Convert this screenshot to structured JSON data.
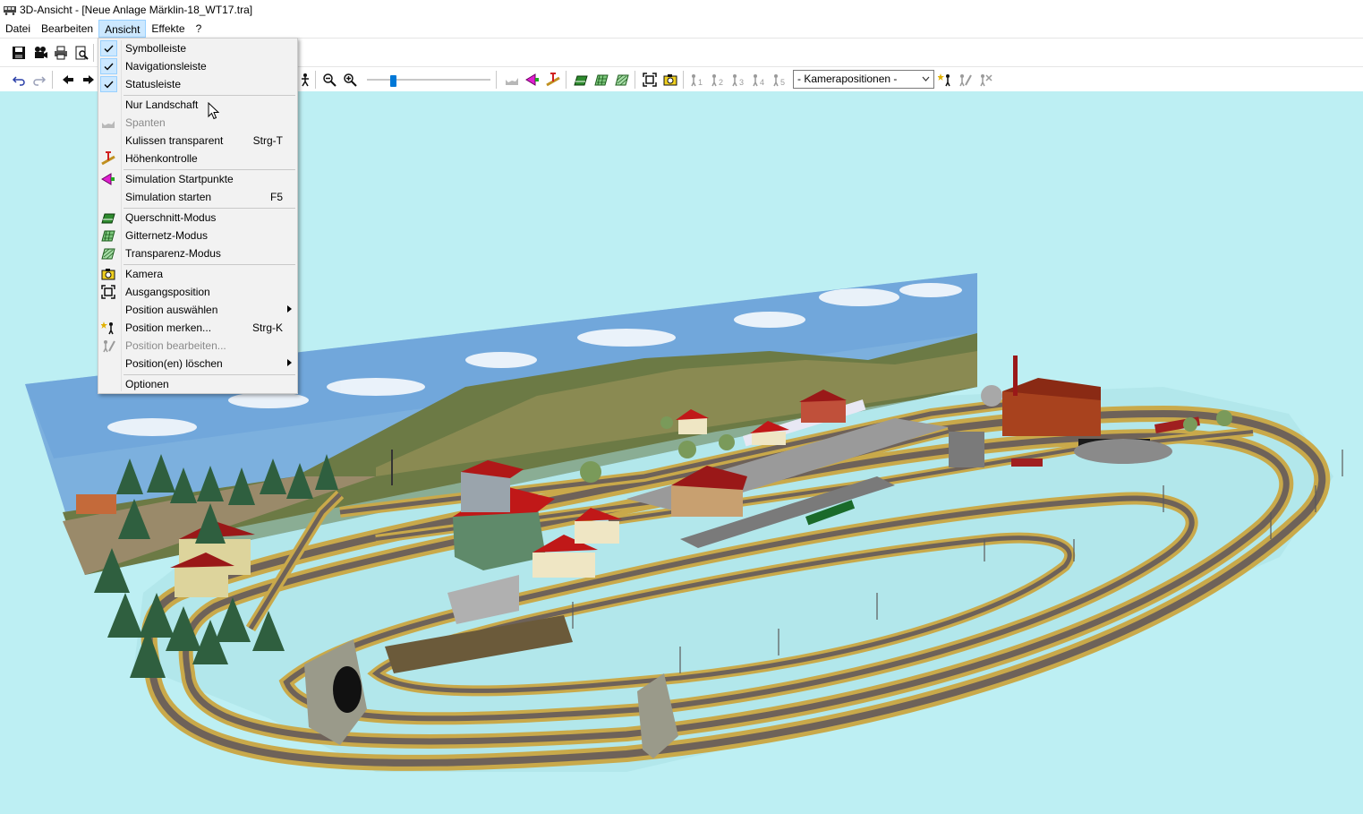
{
  "window": {
    "title": "3D-Ansicht - [Neue Anlage Märklin-18_WT17.tra]"
  },
  "menubar": {
    "items": [
      {
        "label": "Datei",
        "active": false
      },
      {
        "label": "Bearbeiten",
        "active": false
      },
      {
        "label": "Ansicht",
        "active": true
      },
      {
        "label": "Effekte",
        "active": false
      },
      {
        "label": "?",
        "active": false
      }
    ]
  },
  "toolbar": {
    "camera_select": {
      "value": "- Kamerapositionen -"
    },
    "zoom_slider_value_percent": 20
  },
  "ansicht_menu": {
    "items": [
      {
        "label": "Symbolleiste",
        "checked": true,
        "disabled": false,
        "shortcut": "",
        "submenu": false,
        "icon": "check-icon"
      },
      {
        "label": "Navigationsleiste",
        "checked": true,
        "disabled": false,
        "shortcut": "",
        "submenu": false,
        "icon": "check-icon"
      },
      {
        "label": "Statusleiste",
        "checked": true,
        "disabled": false,
        "shortcut": "",
        "submenu": false,
        "icon": "check-icon"
      },
      {
        "label": "Nur Landschaft",
        "checked": false,
        "disabled": false,
        "shortcut": "",
        "submenu": false,
        "icon": ""
      },
      {
        "label": "Spanten",
        "checked": false,
        "disabled": true,
        "shortcut": "",
        "submenu": false,
        "icon": "spanten-icon"
      },
      {
        "label": "Kulissen transparent",
        "checked": false,
        "disabled": false,
        "shortcut": "Strg-T",
        "submenu": false,
        "icon": ""
      },
      {
        "label": "Höhenkontrolle",
        "checked": false,
        "disabled": false,
        "shortcut": "",
        "submenu": false,
        "icon": "height-check-icon"
      },
      {
        "label": "Simulation Startpunkte",
        "checked": false,
        "disabled": false,
        "shortcut": "",
        "submenu": false,
        "icon": "simulation-start-icon"
      },
      {
        "label": "Simulation starten",
        "checked": false,
        "disabled": false,
        "shortcut": "F5",
        "submenu": false,
        "icon": ""
      },
      {
        "label": "Querschnitt-Modus",
        "checked": false,
        "disabled": false,
        "shortcut": "",
        "submenu": false,
        "icon": "cross-section-icon"
      },
      {
        "label": "Gitternetz-Modus",
        "checked": false,
        "disabled": false,
        "shortcut": "",
        "submenu": false,
        "icon": "grid-mode-icon"
      },
      {
        "label": "Transparenz-Modus",
        "checked": false,
        "disabled": false,
        "shortcut": "",
        "submenu": false,
        "icon": "transparency-mode-icon"
      },
      {
        "label": "Kamera",
        "checked": false,
        "disabled": false,
        "shortcut": "",
        "submenu": false,
        "icon": "camera-icon"
      },
      {
        "label": "Ausgangsposition",
        "checked": false,
        "disabled": false,
        "shortcut": "",
        "submenu": false,
        "icon": "home-position-icon"
      },
      {
        "label": "Position auswählen",
        "checked": false,
        "disabled": false,
        "shortcut": "",
        "submenu": true,
        "icon": ""
      },
      {
        "label": "Position merken...",
        "checked": false,
        "disabled": false,
        "shortcut": "Strg-K",
        "submenu": false,
        "icon": "position-mark-icon"
      },
      {
        "label": "Position bearbeiten...",
        "checked": false,
        "disabled": true,
        "shortcut": "",
        "submenu": false,
        "icon": "position-edit-icon"
      },
      {
        "label": "Position(en) löschen",
        "checked": false,
        "disabled": false,
        "shortcut": "",
        "submenu": true,
        "icon": ""
      },
      {
        "label": "Optionen",
        "checked": false,
        "disabled": false,
        "shortcut": "",
        "submenu": false,
        "icon": ""
      }
    ]
  },
  "colors": {
    "viewport_background": "#bdeff3",
    "menu_highlight": "#cce8ff",
    "track_ballast": "#c9a94a",
    "track_rails": "#6e6259"
  }
}
